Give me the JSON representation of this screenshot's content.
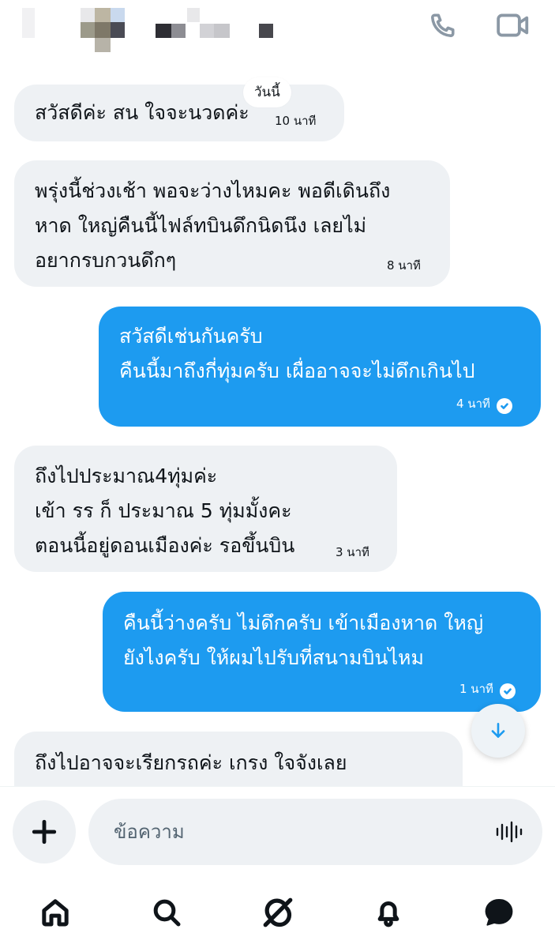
{
  "today_label": "วันนี้",
  "messages": [
    {
      "direction": "incoming",
      "lines": [
        "สวัสดีค่ะ สน ใจจะนวดค่ะ"
      ],
      "time": "10 นาที"
    },
    {
      "direction": "incoming",
      "lines": [
        "พรุ่งนี้ช่วงเช้า พอจะว่างไหมคะ พอดีเดินถึง",
        "หาด ใหญ่คืนนี้ไฟล์ทบินดึกนิดนึง เลยไม่",
        "อยากรบกวนดึกๆ"
      ],
      "time": "8 นาที"
    },
    {
      "direction": "outgoing",
      "lines": [
        "สวัสดีเช่นกันครับ",
        "คืนนี้มาถึงกี่ทุ่มครับ เผื่ออาจจะไม่ดึกเกินไป"
      ],
      "time": "4 นาที",
      "read": true
    },
    {
      "direction": "incoming",
      "lines": [
        "ถึงไปประมาณ4ทุ่มค่ะ",
        "เข้า รร ก็ ประมาณ 5 ทุ่มมั้งคะ",
        "ตอนนี้อยู่ดอนเมืองค่ะ รอขึ้นบิน"
      ],
      "time": "3 นาที"
    },
    {
      "direction": "outgoing",
      "lines": [
        "คืนนี้ว่างครับ ไม่ดึกครับ เข้าเมืองหาด ใหญ่",
        "ยังไงครับ ให้ผมไปรับที่สนามบินไหม"
      ],
      "time": "1 นาที",
      "read": true
    },
    {
      "direction": "incoming",
      "lines": [
        "ถึงไปอาจจะเรียกรถค่ะ เกรง ใจจังเลย"
      ],
      "time": ""
    }
  ],
  "composer": {
    "placeholder": "ข้อความ"
  },
  "icons": {
    "call": "phone-icon",
    "video": "video-camera-icon",
    "add": "plus-icon",
    "voice": "voice-waveform-icon",
    "scroll_down": "arrow-down-icon",
    "nav": [
      "home-icon",
      "search-icon",
      "grok-icon",
      "notifications-bell-icon",
      "messages-icon"
    ]
  },
  "colors": {
    "accent": "#1d9bf0",
    "incoming_bubble": "#eef1f4",
    "text": "#0f1419",
    "muted_icon": "#8b98a5"
  }
}
